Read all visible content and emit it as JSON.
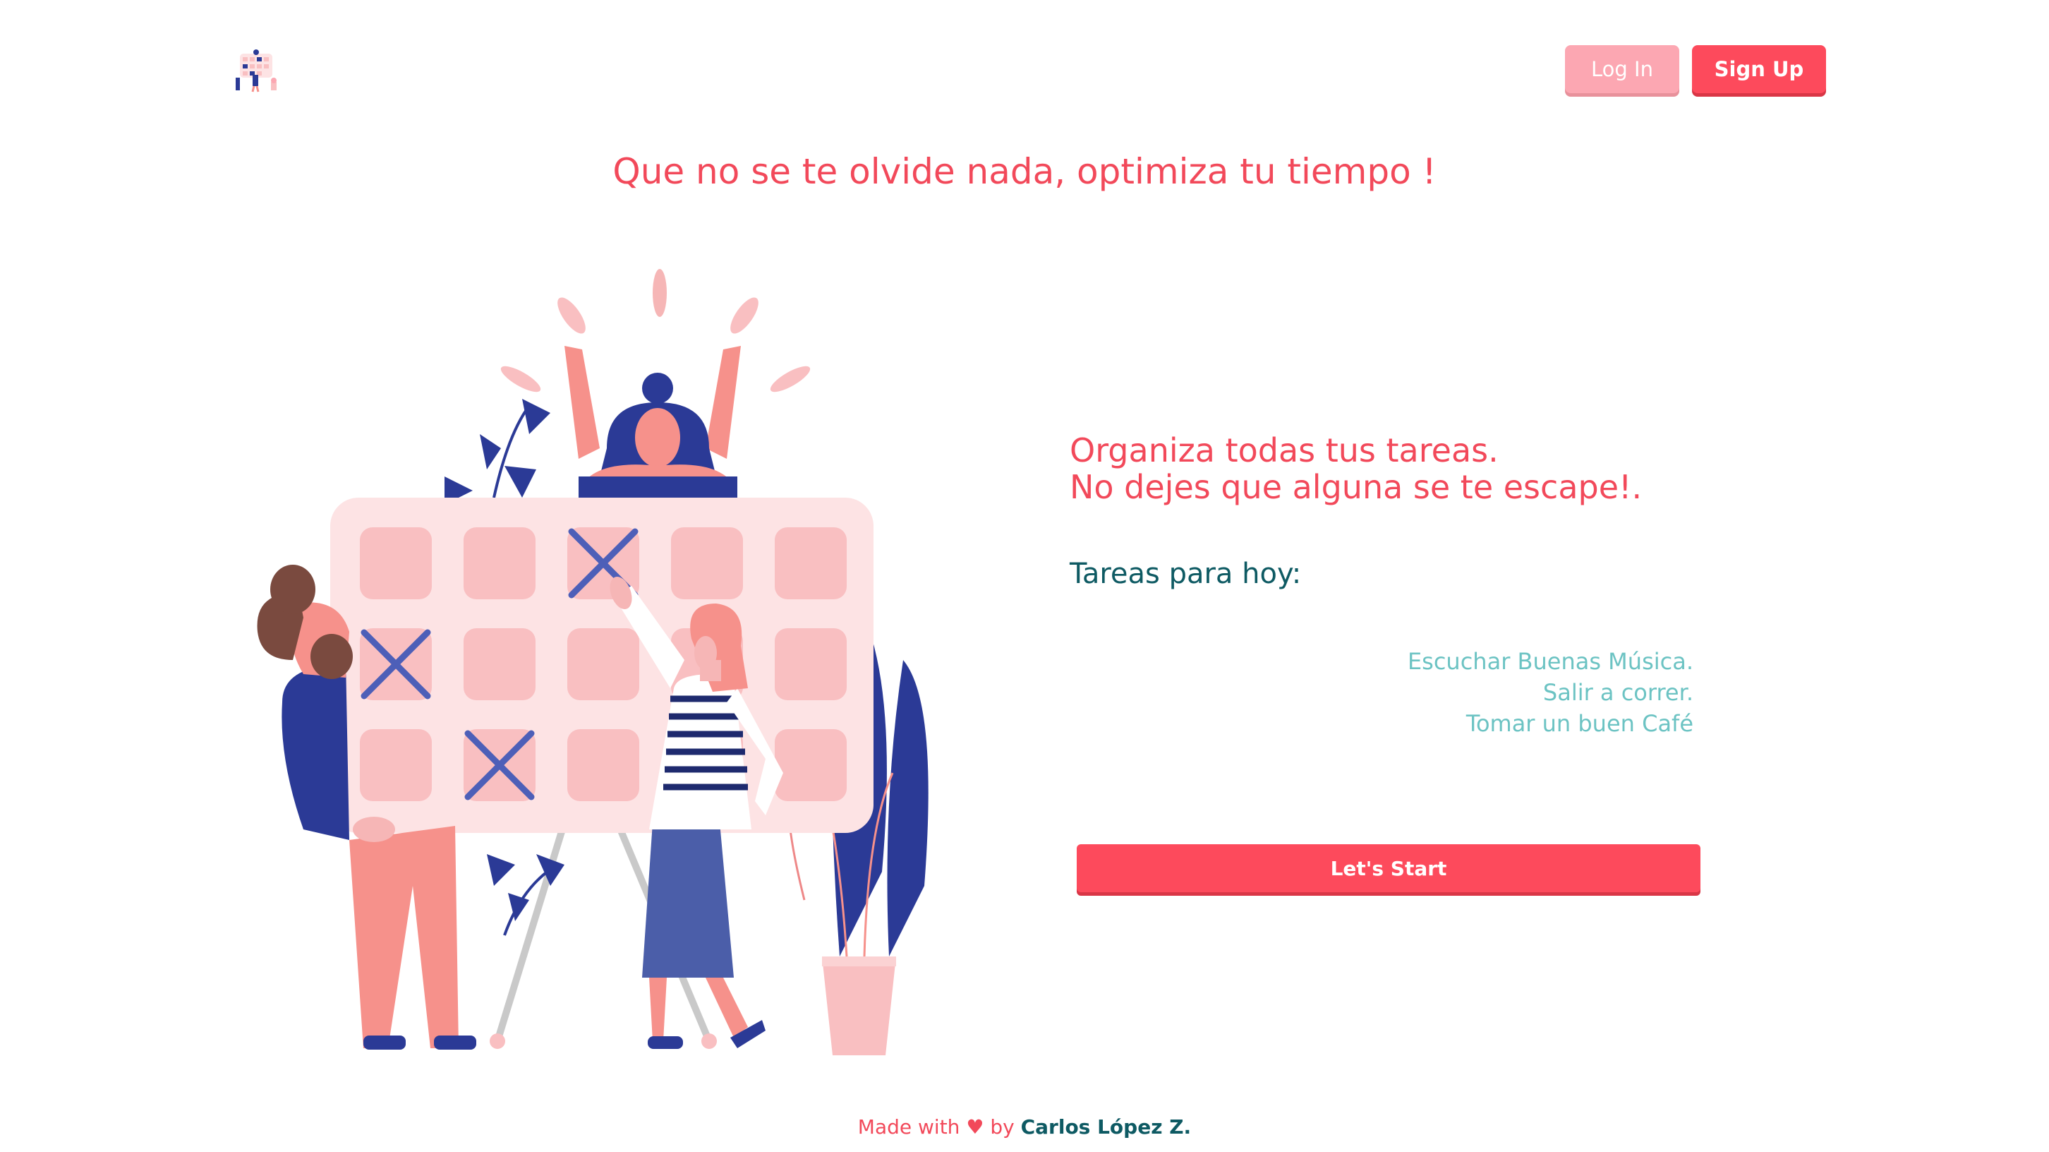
{
  "header": {
    "login_label": "Log In",
    "signup_label": "Sign Up"
  },
  "main": {
    "headline": "Que no se te olvide nada, optimiza tu tiempo !",
    "subtitle_line1": "Organiza todas tus tareas.",
    "subtitle_line2": "No dejes que alguna se te escape!.",
    "tasks_heading": "Tareas para hoy:",
    "tasks": [
      "Escuchar Buenas Música.",
      "Salir a correr.",
      "Tomar un buen Café"
    ],
    "start_label": "Let's Start"
  },
  "footer": {
    "made_with": "Made with",
    "heart": "♥",
    "by": "by",
    "author": "Carlos López Z."
  },
  "colors": {
    "primary": "#fd4a5c",
    "primary_light": "#fca7b2",
    "heading": "#f2495a",
    "dark_teal": "#0e5a63",
    "light_teal": "#6cc3c3",
    "navy": "#2b3a96",
    "pink": "#f6918b",
    "calendar_bg": "#fde3e4",
    "cell": "#f9bfc1"
  },
  "icons": {
    "logo": "calendar-logo-icon"
  }
}
